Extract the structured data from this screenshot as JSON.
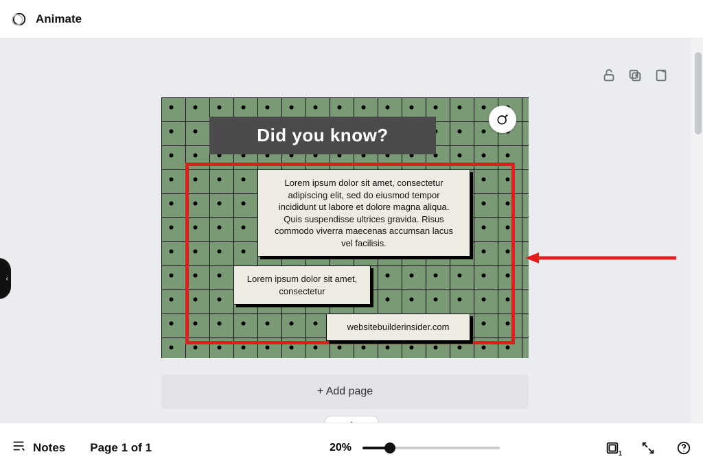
{
  "topbar": {
    "animate_label": "Animate"
  },
  "slide": {
    "title": "Did you know?",
    "card1": "Lorem ipsum dolor sit amet, consectetur adipiscing elit, sed do eiusmod tempor incididunt ut labore et dolore magna aliqua. Quis suspendisse ultrices gravida. Risus commodo viverra maecenas accumsan lacus vel facilisis.",
    "card2": "Lorem ipsum dolor sit amet, consectetur",
    "card3": "websitebuilderinsider.com"
  },
  "add_page_label": "+ Add page",
  "bottombar": {
    "notes_label": "Notes",
    "page_indicator": "Page 1 of 1",
    "zoom_label": "20%",
    "grid_badge": "1"
  },
  "icons": {
    "motion": "motion-icon",
    "unlock": "unlock-icon",
    "duplicate": "duplicate-page-icon",
    "new": "new-page-icon",
    "ai": "magic-icon",
    "notes": "notes-icon",
    "grid": "grid-view-icon",
    "fullscreen": "fullscreen-icon",
    "help": "help-icon",
    "chevron_up": "chevron-up-icon"
  }
}
